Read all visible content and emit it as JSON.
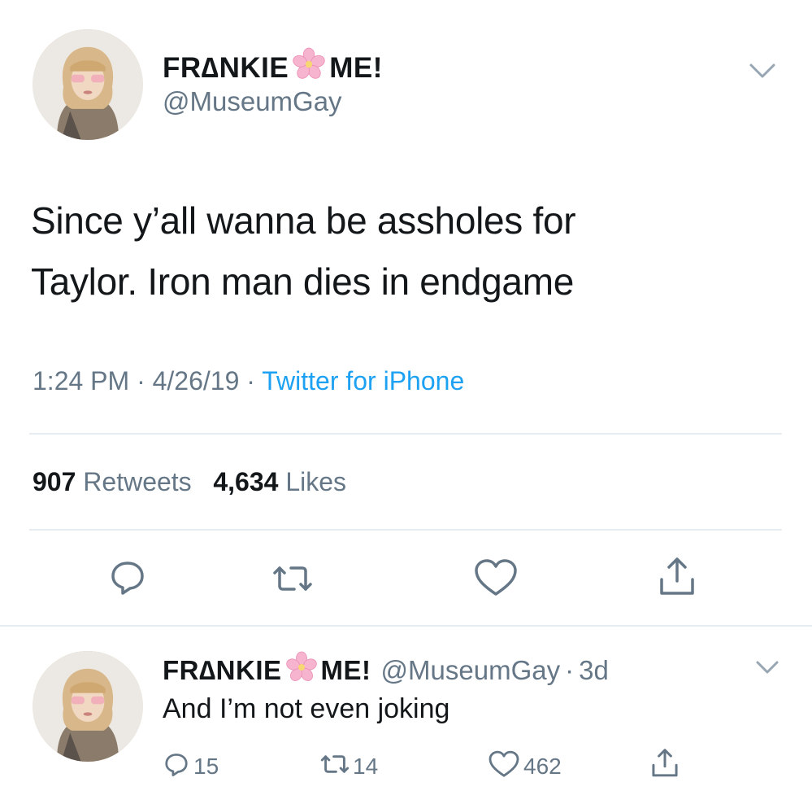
{
  "tweet": {
    "display_name_left": "FR∆NKIE",
    "display_name_right": "ME!",
    "handle": "@MuseumGay",
    "text_line1": "Since y’all wanna be assholes for",
    "text_line2": "Taylor. Iron man dies in endgame",
    "time": "1:24 PM",
    "sep1": "·",
    "date": "4/26/19",
    "sep2": "·",
    "source": "Twitter for iPhone",
    "retweets_count": "907",
    "retweets_label": "Retweets",
    "likes_count": "4,634",
    "likes_label": "Likes"
  },
  "reply": {
    "display_name_left": "FR∆NKIE",
    "display_name_right": "ME!",
    "handle": "@MuseumGay",
    "sep": "·",
    "age": "3d",
    "text": "And I’m not even joking",
    "replies": "15",
    "retweets": "14",
    "likes": "462"
  },
  "icons": {
    "name_emoji": "cherry-blossom-icon",
    "menu": "chevron-down-icon",
    "reply": "reply-bubble-icon",
    "retweet": "retweet-icon",
    "like": "heart-icon",
    "share": "share-icon"
  },
  "colors": {
    "text": "#14171a",
    "secondary": "#657786",
    "link": "#1da1f2",
    "flower": "#f4a6c8"
  }
}
